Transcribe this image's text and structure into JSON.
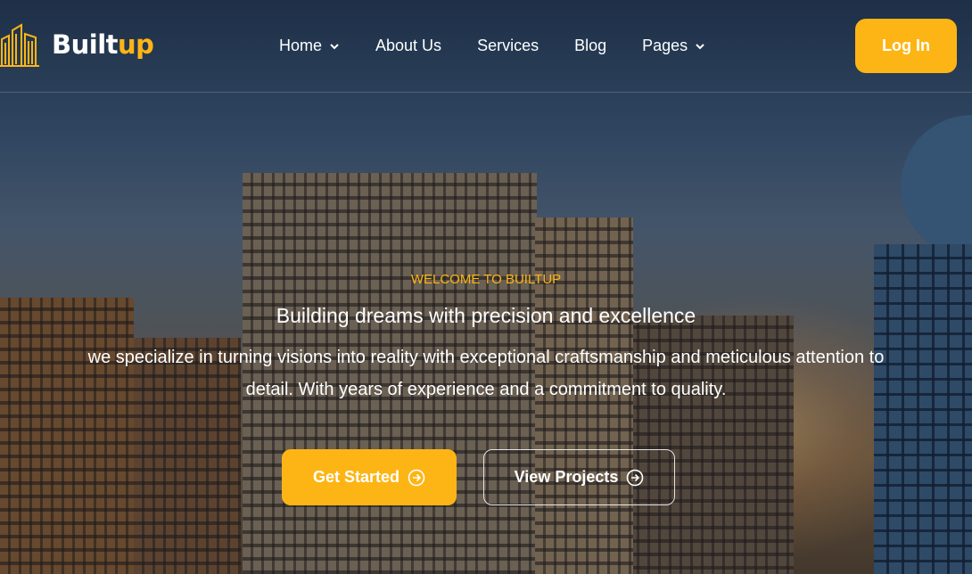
{
  "brand": {
    "name_part1": "Built",
    "name_part2": "up",
    "accent_color": "#fdb515"
  },
  "nav": {
    "items": [
      {
        "label": "Home",
        "has_dropdown": true
      },
      {
        "label": "About Us",
        "has_dropdown": false
      },
      {
        "label": "Services",
        "has_dropdown": false
      },
      {
        "label": "Blog",
        "has_dropdown": false
      },
      {
        "label": "Pages",
        "has_dropdown": true
      }
    ],
    "login_label": "Log In"
  },
  "hero": {
    "eyebrow": "WELCOME TO BUILTUP",
    "headline": "Building dreams with precision and excellence",
    "description": "we specialize in turning visions into reality with exceptional craftsmanship and meticulous attention to detail. With years of experience and a commitment to quality.",
    "primary_cta": {
      "label": "Get Started",
      "icon": "arrow-circle-right-icon"
    },
    "secondary_cta": {
      "label": "View Projects",
      "icon": "arrow-circle-right-icon"
    }
  }
}
